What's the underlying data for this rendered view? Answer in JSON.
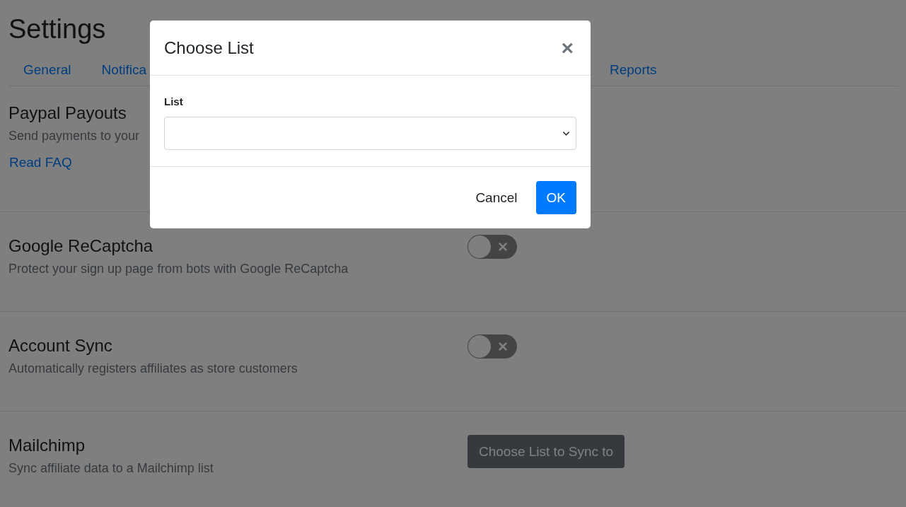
{
  "page": {
    "title": "Settings"
  },
  "tabs": [
    {
      "label": "General",
      "selected": false
    },
    {
      "label": "Notifica",
      "selected": false
    },
    {
      "label": "Reports",
      "selected": false
    }
  ],
  "sections": [
    {
      "kind": "link",
      "title": "Paypal Payouts",
      "description": "Send payments to your",
      "link": "Read FAQ"
    },
    {
      "kind": "toggle",
      "title": "Google ReCaptcha",
      "description": "Protect your sign up page from bots with Google ReCaptcha",
      "on": false
    },
    {
      "kind": "toggle",
      "title": "Account Sync",
      "description": "Automatically registers affiliates as store customers",
      "on": false
    },
    {
      "kind": "button",
      "title": "Mailchimp",
      "description": "Sync affiliate data to a Mailchimp list",
      "button": "Choose List to Sync to"
    }
  ],
  "modal": {
    "title": "Choose List",
    "close": "×",
    "field_label": "List",
    "buttons": [
      "Cancel",
      "OK"
    ]
  }
}
